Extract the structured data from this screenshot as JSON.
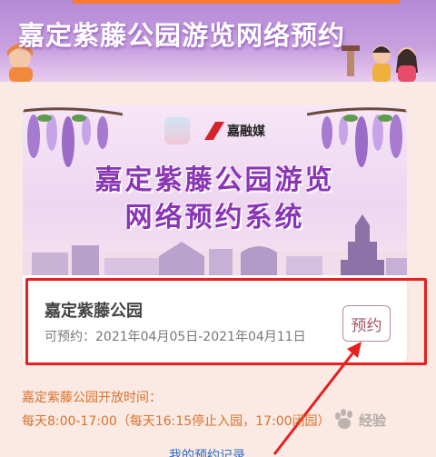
{
  "banner": {
    "title": "嘉定紫藤公园游览网络预约"
  },
  "hero": {
    "logo_text": "嘉融媒",
    "title_line1": "嘉定紫藤公园游览",
    "title_line2": "网络预约系统"
  },
  "park": {
    "name": "嘉定紫藤公园",
    "dates": "可预约：2021年04月05日-2021年04月11日",
    "reserve_label": "预约"
  },
  "info": {
    "open_label": "嘉定紫藤公园开放时间：",
    "open_hours": "每天8:00-17:00（每天16:15停止入园，17:00闭园）"
  },
  "footer": {
    "my_records": "我的预约记录"
  },
  "watermark": {
    "text": "经验"
  },
  "colors": {
    "banner": "#b48ad6",
    "page_bg": "#fbe9e3",
    "hero_title": "#8a35b6",
    "info_text": "#d9722c",
    "link": "#2f6fc4",
    "highlight": "#e5201f",
    "button_text": "#a35668"
  }
}
